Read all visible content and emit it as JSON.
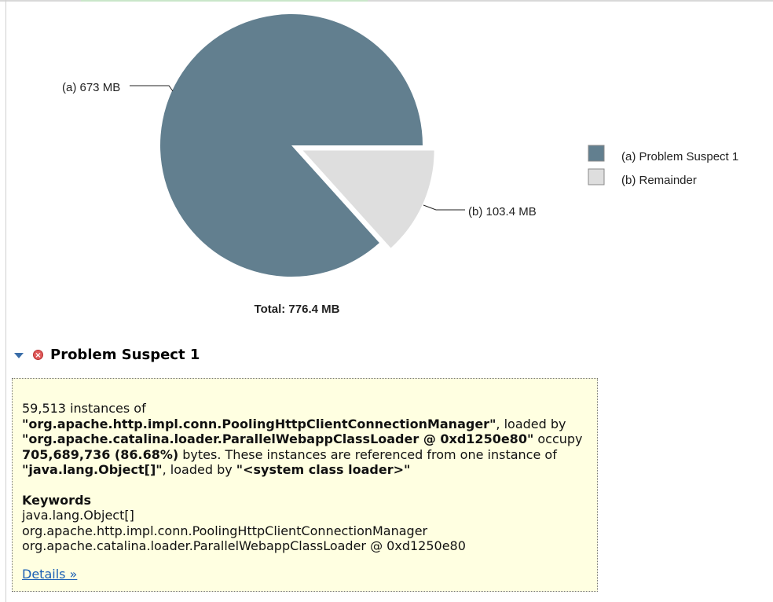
{
  "chart_data": {
    "type": "pie",
    "slices": [
      {
        "id": "a",
        "label": "(a)  673 MB",
        "value": 673,
        "unit": "MB",
        "legend": "(a)  Problem Suspect 1",
        "color": "#627f8f",
        "exploded": false
      },
      {
        "id": "b",
        "label": "(b)  103.4 MB",
        "value": 103.4,
        "unit": "MB",
        "legend": "(b)  Remainder",
        "color": "#dedede",
        "exploded": true
      }
    ],
    "total_label": "Total: 776.4 MB",
    "total": 776.4,
    "legend_position": "right"
  },
  "suspect": {
    "title": "Problem Suspect 1",
    "icon": "error-icon",
    "description": {
      "instances": "59,513 instances of",
      "class_name": "\"org.apache.http.impl.conn.PoolingHttpClientConnectionManager\"",
      "loaded_by_1": ", loaded by",
      "loader": "\"org.apache.catalina.loader.ParallelWebappClassLoader @ 0xd1250e80\"",
      "occupy": " occupy",
      "bytes": "705,689,736 (86.68%)",
      "referenced": " bytes. These instances are referenced from one instance of",
      "ref_class": "\"java.lang.Object[]\"",
      "loaded_by_2": ", loaded by ",
      "system_loader": "\"<system class loader>\""
    },
    "keywords_heading": "Keywords",
    "keywords": [
      "java.lang.Object[]",
      "org.apache.http.impl.conn.PoolingHttpClientConnectionManager",
      "org.apache.catalina.loader.ParallelWebappClassLoader @ 0xd1250e80"
    ],
    "details_link": "Details »"
  }
}
